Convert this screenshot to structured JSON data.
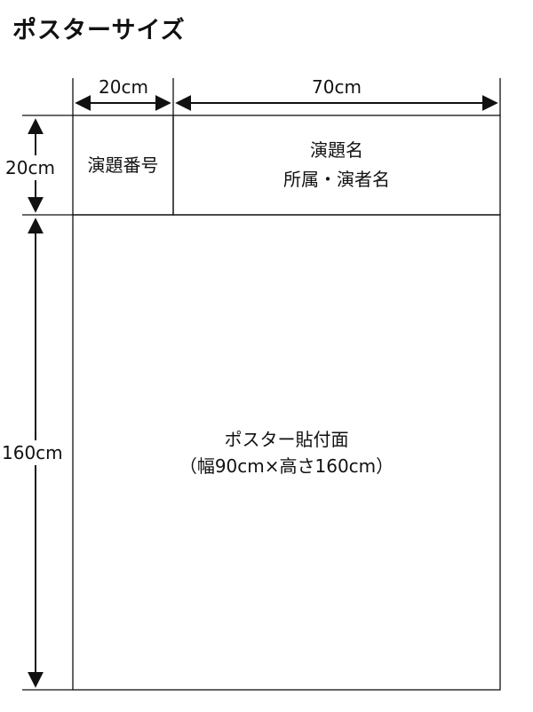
{
  "title": "ポスターサイズ",
  "dimensions": {
    "width_number_cell": "20cm",
    "width_title_cell": "70cm",
    "height_header_row": "20cm",
    "height_poster_area": "160cm"
  },
  "cells": {
    "number": "演題番号",
    "title_line1": "演題名",
    "title_line2": "所属・演者名",
    "poster_line1": "ポスター貼付面",
    "poster_line2": "（幅90cm×高さ160cm）"
  }
}
